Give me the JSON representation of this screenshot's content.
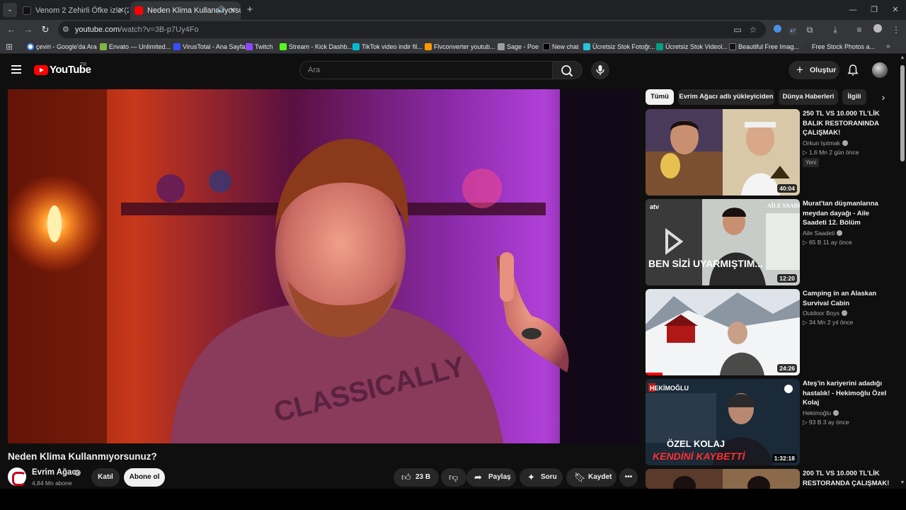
{
  "browser": {
    "tabs": [
      {
        "title": "Venom 2 Zehirli Öfke izle (2",
        "active": false
      },
      {
        "title": "Neden Klima Kullanmıyorsu",
        "active": true
      }
    ],
    "url_host": "youtube.com",
    "url_path": "/watch?v=3B-p7Uy4Fo",
    "extension_badge": "47",
    "bookmarks": [
      {
        "label": "çeviri - Google'da Ara",
        "color": "#4285f4"
      },
      {
        "label": "Envato — Unlimited...",
        "color": "#82b541"
      },
      {
        "label": "VirusTotal - Ana Sayfa",
        "color": "#394eff"
      },
      {
        "label": "Twitch",
        "color": "#9146ff"
      },
      {
        "label": "Stream - Kick Dashb...",
        "color": "#53fc18"
      },
      {
        "label": "TikTok video indir fil...",
        "color": "#00bcd4"
      },
      {
        "label": "Flvconverter youtub...",
        "color": "#ff9800"
      },
      {
        "label": "Sage - Poe",
        "color": "#9e9e9e"
      },
      {
        "label": "New chat",
        "color": "#000000"
      },
      {
        "label": "Ücretsiz Stok Fotoğr...",
        "color": "#26c6da"
      },
      {
        "label": "Ücretsiz Stok Videol...",
        "color": "#05a081"
      },
      {
        "label": "Beautiful Free Imag...",
        "color": "#111111"
      },
      {
        "label": "Free Stock Photos a...",
        "color": "#333333"
      }
    ]
  },
  "header": {
    "logo_text": "YouTube",
    "country": "TR",
    "search_placeholder": "Ara",
    "create_label": "Oluştur"
  },
  "video": {
    "title": "Neden Klima Kullanmıyorsunuz?",
    "channel": "Evrim Ağacı",
    "subscribers": "4,84 Mn abone",
    "join_label": "Katıl",
    "subscribe_label": "Abone ol",
    "likes": "23 B",
    "share_label": "Paylaş",
    "ask_label": "Soru",
    "save_label": "Kaydet",
    "shirt_text": "CLASSICALLY"
  },
  "chips": [
    "Tümü",
    "Evrim Ağacı adlı yükleyiciden",
    "Dünya Haberleri",
    "İlgili"
  ],
  "recommendations": [
    {
      "title": "250 TL VS 10.000 TL'LİK BALIK RESTORANINDA ÇALIŞMAK!",
      "channel": "Orkun Işıtmak",
      "meta": "▷ 1,6 Mn  2 gün önce",
      "duration": "40:04",
      "badge": "Yeni"
    },
    {
      "title": "Murat'tan düşmanlarına meydan dayağı - Aile Saadeti 12. Bölüm",
      "channel": "Aile Saadeti",
      "meta": "▷ 65 B  11 ay önce",
      "duration": "12:20",
      "overlay": "BEN SİZİ UYARMIŞTIM...",
      "logo": "AİLE SAADETİ",
      "brand": "atv"
    },
    {
      "title": "Camping in an Alaskan Survival Cabin",
      "channel": "Outdoor Boys",
      "meta": "▷ 34 Mn  2 yıl önce",
      "duration": "24:26"
    },
    {
      "title": "Ateş'in kariyerini adadığı hastalık! - Hekimoğlu Özel Kolaj",
      "channel": "Hekimoğlu",
      "meta": "▷ 93 B  3 ay önce",
      "duration": "1:32:18",
      "overlay": "ÖZEL KOLAJ",
      "overlay2": "KENDİNİ KAYBETTİ",
      "logo": "HEKİMOĞLU"
    },
    {
      "title": "200 TL VS 10.000 TL'LİK RESTORANDA ÇALIŞMAK!"
    }
  ]
}
